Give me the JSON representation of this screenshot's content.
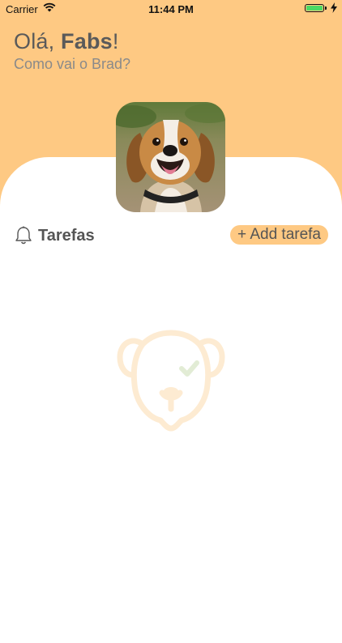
{
  "status_bar": {
    "carrier": "Carrier",
    "time": "11:44 PM",
    "wifi_icon": "wifi-icon",
    "battery_icon": "battery-icon",
    "battery_level": 1.0,
    "charging_icon": "bolt-icon"
  },
  "header": {
    "greeting_prefix": "Olá, ",
    "user_name": "Fabs",
    "greeting_suffix": "!",
    "subtitle": "Como vai o Brad?",
    "background_color": "#fec983"
  },
  "pet": {
    "avatar_icon": "dog-photo"
  },
  "tasks": {
    "icon": "bell-icon",
    "title": "Tarefas",
    "add_button_label": "+ Add tarefa",
    "accent_color": "#fec983",
    "empty_illustration_icon": "dog-check-icon"
  }
}
